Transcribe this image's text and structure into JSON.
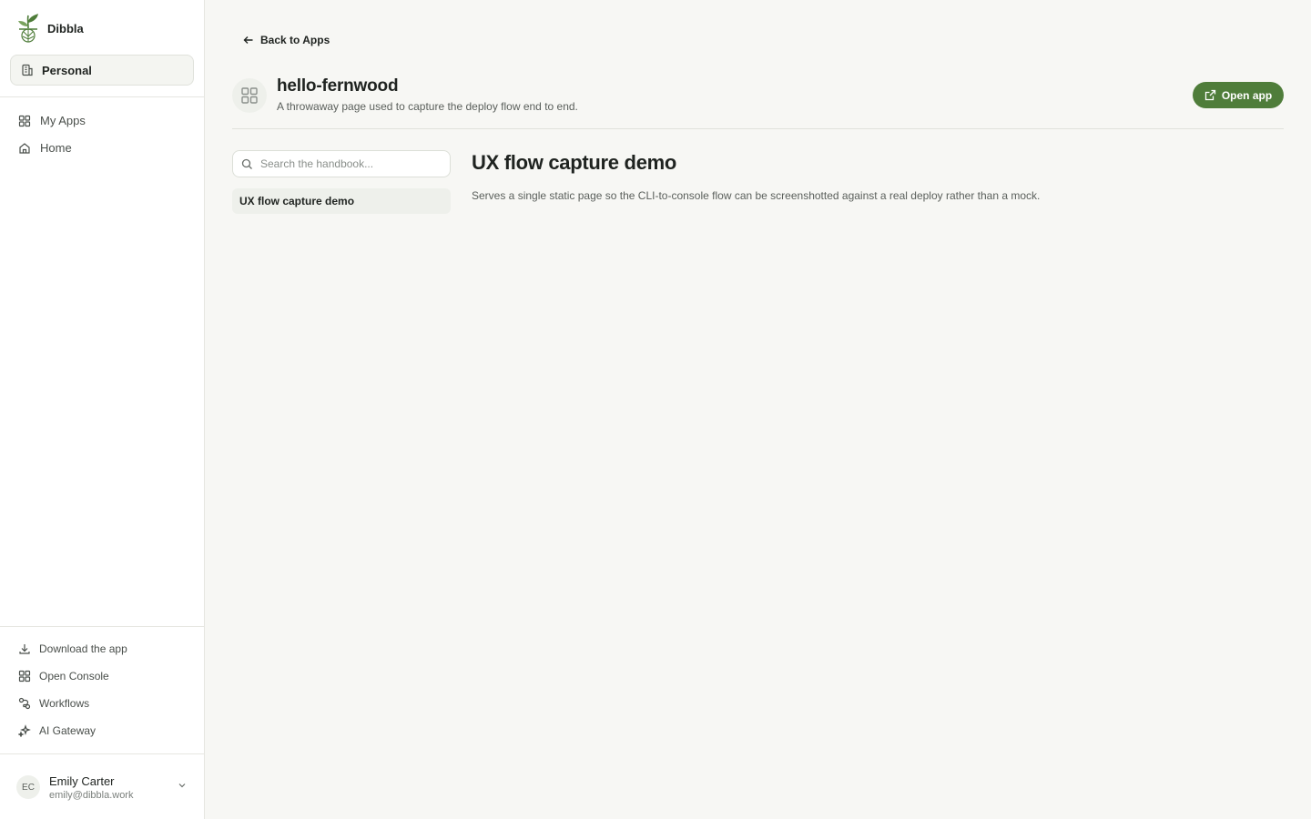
{
  "brand": {
    "name": "Dibbla",
    "accent": "#4f7d3a"
  },
  "workspace": {
    "label": "Personal",
    "icon": "building-icon"
  },
  "nav": [
    {
      "label": "My Apps",
      "icon": "grid-icon"
    },
    {
      "label": "Home",
      "icon": "home-icon"
    }
  ],
  "footer_nav": [
    {
      "label": "Download the app",
      "icon": "download-icon"
    },
    {
      "label": "Open Console",
      "icon": "grid-icon"
    },
    {
      "label": "Workflows",
      "icon": "workflow-icon"
    },
    {
      "label": "AI Gateway",
      "icon": "sparkles-icon"
    }
  ],
  "user": {
    "initials": "EC",
    "name": "Emily Carter",
    "email": "emily@dibbla.work"
  },
  "main": {
    "back_label": "Back to Apps",
    "app": {
      "name": "hello-fernwood",
      "description": "A throwaway page used to capture the deploy flow end to end.",
      "open_label": "Open app"
    },
    "search": {
      "placeholder": "Search the handbook...",
      "value": ""
    },
    "docs": [
      {
        "label": "UX flow capture demo"
      }
    ],
    "doc": {
      "title": "UX flow capture demo",
      "body": "Serves a single static page so the CLI-to-console flow can be screenshotted against a real deploy rather than a mock."
    }
  }
}
